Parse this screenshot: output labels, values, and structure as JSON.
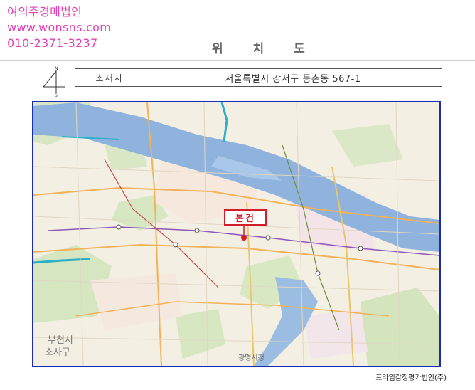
{
  "watermark": {
    "company": "여의주경매법인",
    "website": "www.wonsns.com",
    "phone": "010-2371-3237"
  },
  "document": {
    "title": "위 치 도"
  },
  "address": {
    "label": "소재지",
    "value": "서울특별시 강서구 등촌동 567-1"
  },
  "compass": {
    "north_label": "N",
    "south_label": "S"
  },
  "map": {
    "subject_label": "본건",
    "place_labels": {
      "southwest_city": "부천시",
      "southwest_district": "소사구",
      "south_station": "광명시청"
    }
  },
  "source": "프라임감정평가법인(주)",
  "colors": {
    "watermark": "#e63fb8",
    "map_border": "#1a2bb5",
    "river": "#8fb3dc",
    "pin": "#d41c2a"
  }
}
